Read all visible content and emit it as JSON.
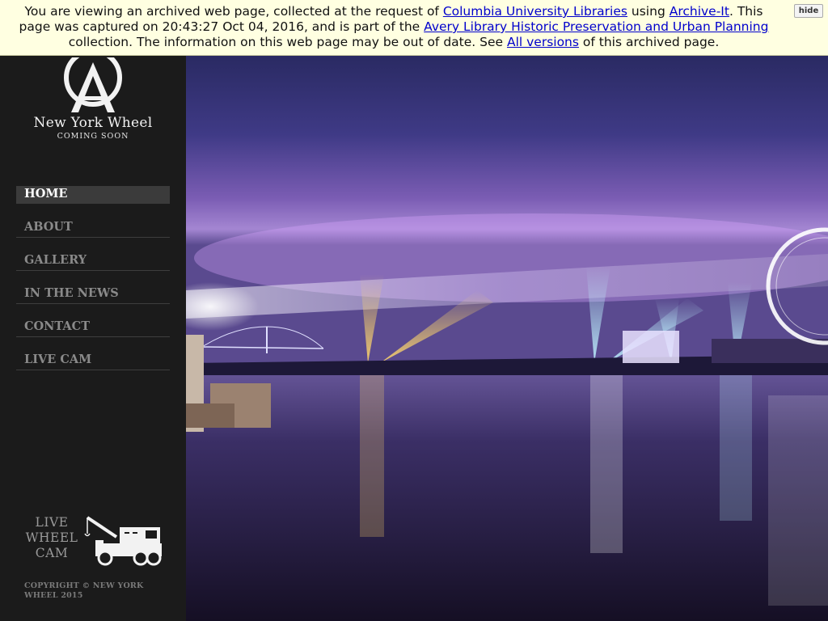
{
  "archive_banner": {
    "text_1": "You are viewing an archived web page, collected at the request of ",
    "link_library": "Columbia University Libraries",
    "text_2": " using ",
    "link_archive_it": "Archive-It",
    "text_3": ". This page was captured on 20:43:27 Oct 04, 2016, and is part of the ",
    "link_collection": "Avery Library Historic Preservation and Urban Planning",
    "text_4": " collection. The information on this web page may be out of date. See ",
    "link_versions": "All versions",
    "text_5": " of this archived page.",
    "hide_label": "hide"
  },
  "site": {
    "logo_title": "New York Wheel",
    "logo_subtitle": "COMING SOON"
  },
  "nav": {
    "items": [
      {
        "label": "HOME",
        "active": true
      },
      {
        "label": "ABOUT",
        "active": false
      },
      {
        "label": "GALLERY",
        "active": false
      },
      {
        "label": "IN THE NEWS",
        "active": false
      },
      {
        "label": "CONTACT",
        "active": false
      },
      {
        "label": "LIVE CAM",
        "active": false
      }
    ]
  },
  "live_cam_promo": {
    "line_1": "LIVE",
    "line_2": "WHEEL",
    "line_3": "CAM",
    "icon": "crane-truck-icon"
  },
  "footer": {
    "copyright": "COPYRIGHT © NEW YORK WHEEL 2015"
  },
  "colors": {
    "sidebar_bg": "#1b1b1b",
    "banner_bg": "#ffffe1",
    "link": "#0000cc",
    "nav_active_bg": "#3b3b3b",
    "nav_text": "#8a8a8a"
  }
}
